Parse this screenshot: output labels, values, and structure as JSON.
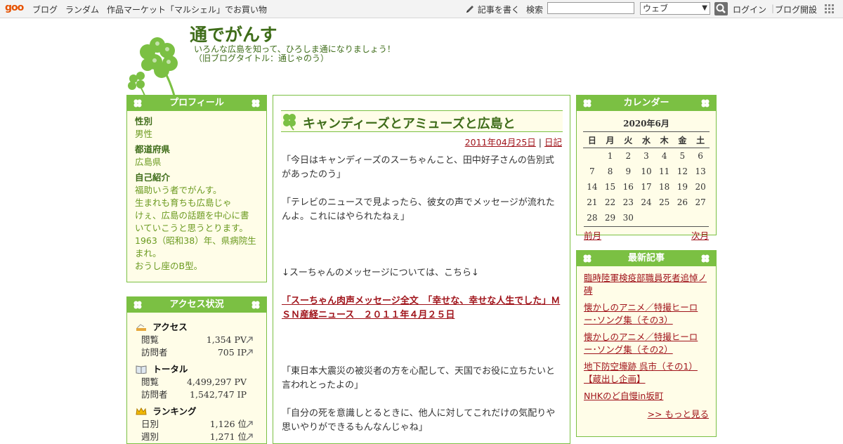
{
  "topbar": {
    "logo": "goo",
    "nav": [
      "ブログ",
      "ランダム",
      "作品マーケット「マルシェル」でお買い物"
    ],
    "write": "記事を書く",
    "search_label": "検索",
    "search_value": "",
    "search_scope": "ウェブ",
    "login": "ログイン",
    "separator": "|",
    "blog_start": "ブログ開設"
  },
  "header": {
    "title": "通でがんす",
    "tagline_1": "いろんな広島を知って、ひろしま通になりましょう！",
    "tagline_2": "（旧ブログタイトル：通じゃのう）"
  },
  "profile": {
    "heading": "プロフィール",
    "gender_label": "性別",
    "gender": "男性",
    "pref_label": "都道府県",
    "pref": "広島県",
    "intro_label": "自己紹介",
    "intro": [
      "福助いう者でがんす。",
      "生まれも育ちも広島じゃ",
      "けぇ、広島の話題を中心に書",
      "いていこうと思うとります。",
      "1963（昭和38）年、県病院生",
      "まれ。",
      "おうし座のB型。"
    ]
  },
  "access": {
    "heading": "アクセス状況",
    "access_title": "アクセス",
    "access_rows": [
      {
        "label": "閲覧",
        "value": "1,354 PV"
      },
      {
        "label": "訪問者",
        "value": "705 IP"
      }
    ],
    "total_title": "トータル",
    "total_rows": [
      {
        "label": "閲覧",
        "value": "4,499,297 PV"
      },
      {
        "label": "訪問者",
        "value": "1,542,747 IP"
      }
    ],
    "rank_title": "ランキング",
    "rank_rows": [
      {
        "label": "日別",
        "value": "1,126 位"
      },
      {
        "label": "週別",
        "value": "1,271 位"
      }
    ]
  },
  "article": {
    "title": "キャンディーズとアミューズと広島と",
    "date": "2011年04月25日",
    "meta_sep": "|",
    "category": "日記",
    "p1": "「今日はキャンディーズのスーちゃんこと、田中好子さんの告別式があったのう」",
    "p2": "「テレビのニュースで見よったら、彼女の声でメッセージが流れたんよ。これにはやられたねぇ」",
    "p3": "↓スーちゃんのメッセージについては、こちら↓",
    "link": "「スーちゃん肉声メッセージ全文　「幸せな、幸せな人生でした」ＭＳＮ産経ニュース　２０１１年４月２５日",
    "p4": "「東日本大震災の被災者の方を心配して、天国でお役に立ちたいと言われとったよの」",
    "p5": "「自分の死を意識しとるときに、他人に対してこれだけの気配りや思いやりができるもんなんじゃね」"
  },
  "calendar": {
    "heading": "カレンダー",
    "month": "2020年6月",
    "weekdays": [
      "日",
      "月",
      "火",
      "水",
      "木",
      "金",
      "土"
    ],
    "weeks": [
      [
        "",
        "1",
        "2",
        "3",
        "4",
        "5",
        "6"
      ],
      [
        "7",
        "8",
        "9",
        "10",
        "11",
        "12",
        "13"
      ],
      [
        "14",
        "15",
        "16",
        "17",
        "18",
        "19",
        "20"
      ],
      [
        "21",
        "22",
        "23",
        "24",
        "25",
        "26",
        "27"
      ],
      [
        "28",
        "29",
        "30",
        "",
        "",
        "",
        ""
      ]
    ],
    "prev": "前月",
    "next": "次月"
  },
  "recent": {
    "heading": "最新記事",
    "items": [
      "臨時陸軍検疫部職員死者追悼ノ碑",
      "懐かしのアニメ／特撮ヒーロー･ソング集（その3）",
      "懐かしのアニメ／特撮ヒーロー･ソング集（その2）",
      "地下防空壕跡 呉市（その1）【蔵出し企画】",
      "NHKのど自慢in坂町"
    ],
    "more": ">> もっと見る"
  },
  "colors": {
    "accent_green": "#7bc043",
    "title_green": "#3f6d1a",
    "link_red": "#a0141b",
    "box_bg": "#fffde8"
  },
  "icons": [
    "clover-icon",
    "pencil-icon",
    "search-icon",
    "grid-menu-icon",
    "arrow-icon"
  ]
}
